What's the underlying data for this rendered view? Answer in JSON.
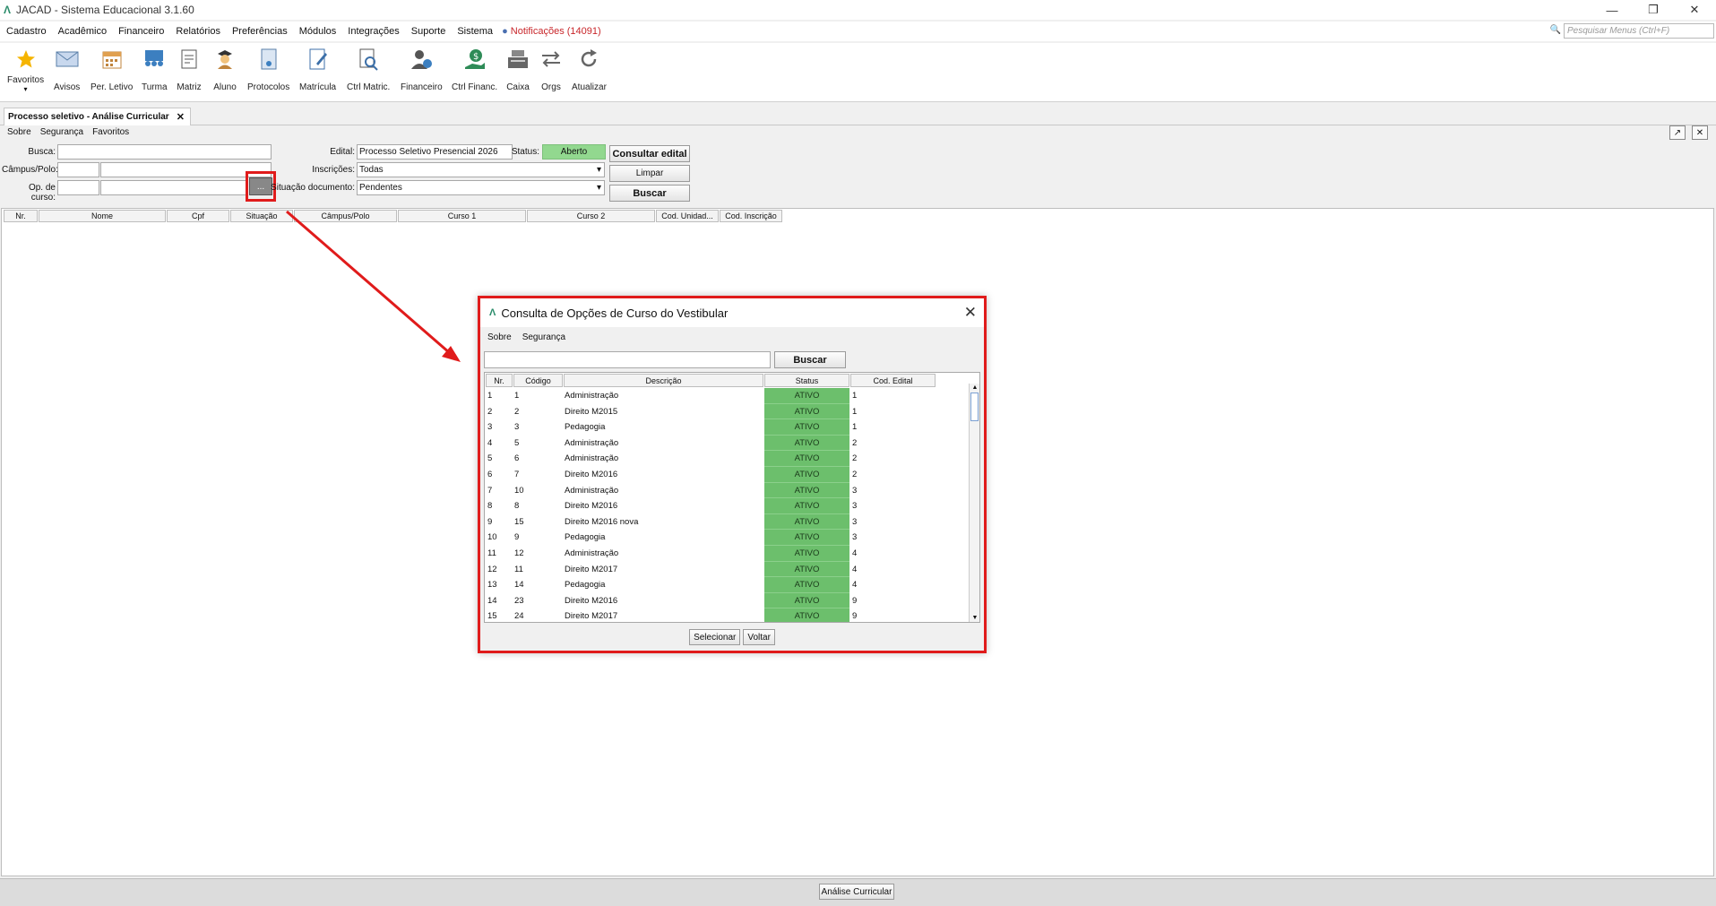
{
  "window": {
    "title": "JACAD - Sistema Educacional 3.1.60",
    "logo": "Λ",
    "controls": [
      "—",
      "❐",
      "✕"
    ]
  },
  "menubar": {
    "items": [
      "Cadastro",
      "Acadêmico",
      "Financeiro",
      "Relatórios",
      "Preferências",
      "Módulos",
      "Integrações",
      "Suporte",
      "Sistema"
    ],
    "notifications": "Notificações (14091)",
    "search_placeholder": "Pesquisar Menus (Ctrl+F)"
  },
  "toolbar": {
    "items": [
      {
        "label": "Favoritos",
        "icon": "star-icon"
      },
      {
        "label": "Avisos",
        "icon": "envelope-icon"
      },
      {
        "label": "Per. Letivo",
        "icon": "calendar-icon"
      },
      {
        "label": "Turma",
        "icon": "class-icon"
      },
      {
        "label": "Matriz",
        "icon": "matrix-document-icon"
      },
      {
        "label": "Aluno",
        "icon": "student-icon"
      },
      {
        "label": "Protocolos",
        "icon": "protocol-icon"
      },
      {
        "label": "Matrícula",
        "icon": "enrollment-icon"
      },
      {
        "label": "Ctrl Matric.",
        "icon": "search-document-icon"
      },
      {
        "label": "Financeiro",
        "icon": "finance-user-icon"
      },
      {
        "label": "Ctrl Financ.",
        "icon": "money-hand-icon"
      },
      {
        "label": "Caixa",
        "icon": "cash-register-icon"
      },
      {
        "label": "Orgs",
        "icon": "swap-arrows-icon"
      },
      {
        "label": "Atualizar",
        "icon": "refresh-icon"
      }
    ]
  },
  "tab": {
    "label": "Processo seletivo - Análise Curricular",
    "close": "✕"
  },
  "submenu": [
    "Sobre",
    "Segurança",
    "Favoritos"
  ],
  "form": {
    "busca_label": "Busca:",
    "campus_label": "Câmpus/Polo:",
    "opcurso_label": "Op. de curso:",
    "lookup_button": "...",
    "edital_label": "Edital:",
    "edital_value": "Processo Seletivo Presencial 2026",
    "status_label": "Status:",
    "status_value": "Aberto",
    "inscricoes_label": "Inscrições:",
    "inscricoes_value": "Todas",
    "situacao_label": "Situação documento:",
    "situacao_value": "Pendentes",
    "consultar_button": "Consultar edital",
    "limpar_button": "Limpar",
    "buscar_button": "Buscar"
  },
  "main_grid": {
    "columns": [
      "Nr.",
      "Nome",
      "Cpf",
      "Situação",
      "Câmpus/Polo",
      "Curso 1",
      "Curso 2",
      "Cod. Unidad...",
      "Cod. Inscrição"
    ]
  },
  "dialog": {
    "title": "Consulta de Opções de Curso do Vestibular",
    "close": "✕",
    "menu": [
      "Sobre",
      "Segurança"
    ],
    "search_value": "",
    "buscar_button": "Buscar",
    "columns": [
      "Nr.",
      "Código",
      "Descrição",
      "Status",
      "Cod. Edital"
    ],
    "rows": [
      {
        "nr": "1",
        "codigo": "1",
        "descricao": "Administração",
        "status": "ATIVO",
        "edital": "1"
      },
      {
        "nr": "2",
        "codigo": "2",
        "descricao": "Direito M2015",
        "status": "ATIVO",
        "edital": "1"
      },
      {
        "nr": "3",
        "codigo": "3",
        "descricao": "Pedagogia",
        "status": "ATIVO",
        "edital": "1"
      },
      {
        "nr": "4",
        "codigo": "5",
        "descricao": "Administração",
        "status": "ATIVO",
        "edital": "2"
      },
      {
        "nr": "5",
        "codigo": "6",
        "descricao": "Administração",
        "status": "ATIVO",
        "edital": "2"
      },
      {
        "nr": "6",
        "codigo": "7",
        "descricao": "Direito M2016",
        "status": "ATIVO",
        "edital": "2"
      },
      {
        "nr": "7",
        "codigo": "10",
        "descricao": "Administração",
        "status": "ATIVO",
        "edital": "3"
      },
      {
        "nr": "8",
        "codigo": "8",
        "descricao": "Direito M2016",
        "status": "ATIVO",
        "edital": "3"
      },
      {
        "nr": "9",
        "codigo": "15",
        "descricao": "Direito M2016 nova",
        "status": "ATIVO",
        "edital": "3"
      },
      {
        "nr": "10",
        "codigo": "9",
        "descricao": "Pedagogia",
        "status": "ATIVO",
        "edital": "3"
      },
      {
        "nr": "11",
        "codigo": "12",
        "descricao": "Administração",
        "status": "ATIVO",
        "edital": "4"
      },
      {
        "nr": "12",
        "codigo": "11",
        "descricao": "Direito M2017",
        "status": "ATIVO",
        "edital": "4"
      },
      {
        "nr": "13",
        "codigo": "14",
        "descricao": "Pedagogia",
        "status": "ATIVO",
        "edital": "4"
      },
      {
        "nr": "14",
        "codigo": "23",
        "descricao": "Direito M2016",
        "status": "ATIVO",
        "edital": "9"
      },
      {
        "nr": "15",
        "codigo": "24",
        "descricao": "Direito M2017",
        "status": "ATIVO",
        "edital": "9"
      }
    ],
    "selecionar_button": "Selecionar",
    "voltar_button": "Voltar"
  },
  "statusbar": {
    "analise_button": "Análise Curricular"
  },
  "colors": {
    "accent_red": "#e01b1b",
    "status_green": "#6cbf6c",
    "open_green": "#92d88f",
    "notif_red": "#c8262a",
    "logo_green": "#2a8c6a"
  }
}
